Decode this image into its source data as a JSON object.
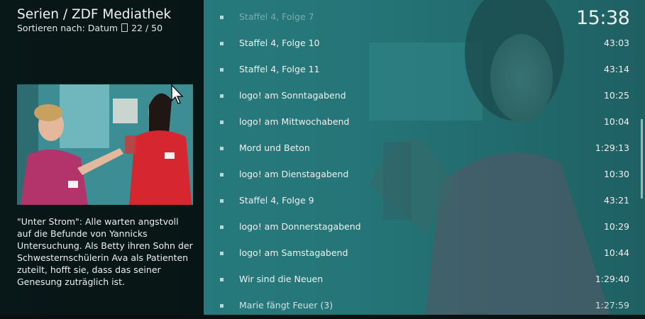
{
  "header": {
    "title": "Serien / ZDF Mediathek",
    "sort_label": "Sortieren nach: Datum",
    "sort_icon": "sort-order-icon",
    "position": "22 / 50"
  },
  "clock": "15:38",
  "plot": "\"Unter Strom\": Alle warten angstvoll auf die Befunde von Yannicks Untersuchung. Als Betty ihren Sohn der Schwesternschülerin Ava als Patienten zuteilt, hofft sie, dass das seiner Genesung zuträglich ist.",
  "episodes": [
    {
      "title": "Staffel 4, Folge 7",
      "duration": "",
      "state": "faded"
    },
    {
      "title": "Staffel 4, Folge 10",
      "duration": "43:03",
      "state": "normal"
    },
    {
      "title": "Staffel 4, Folge 11",
      "duration": "43:14",
      "state": "normal"
    },
    {
      "title": "logo! am Sonntagabend",
      "duration": "10:25",
      "state": "normal"
    },
    {
      "title": "logo! am Mittwochabend",
      "duration": "10:04",
      "state": "normal"
    },
    {
      "title": "Mord und Beton",
      "duration": "1:29:13",
      "state": "normal"
    },
    {
      "title": "logo! am Dienstagabend",
      "duration": "10:30",
      "state": "normal"
    },
    {
      "title": "Staffel 4, Folge 9",
      "duration": "43:21",
      "state": "selected"
    },
    {
      "title": "logo! am Donnerstagabend",
      "duration": "10:29",
      "state": "normal"
    },
    {
      "title": "logo! am Samstagabend",
      "duration": "10:44",
      "state": "normal"
    },
    {
      "title": "Wir sind die Neuen",
      "duration": "1:29:40",
      "state": "normal"
    },
    {
      "title": "Marie fängt Feuer (3)",
      "duration": "1:27:59",
      "state": "dim"
    }
  ],
  "colors": {
    "list_overlay": "#2e8e90",
    "panel": "#000000"
  }
}
